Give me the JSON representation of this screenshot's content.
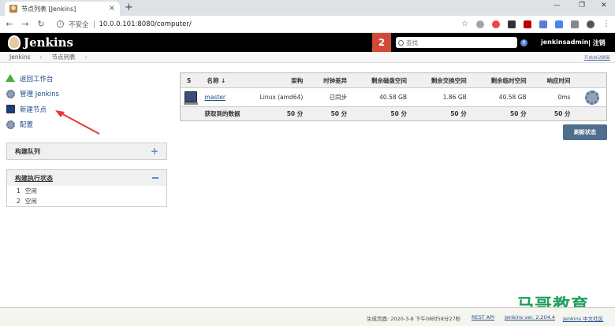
{
  "browser": {
    "tab_title": "节点列表 [Jenkins]",
    "tab_close": "×",
    "new_tab": "+",
    "window_controls": {
      "minimize": "—",
      "restore": "❐",
      "close": "✕"
    },
    "nav": {
      "back": "←",
      "forward": "→",
      "reload": "↻"
    },
    "security_label": "不安全",
    "url": "10.0.0.101:8080/computer/"
  },
  "header": {
    "brand": "Jenkins",
    "notification_count": "2",
    "search_placeholder": "查找",
    "help": "?",
    "user": "jenkinsadmin",
    "logout": "| 注销"
  },
  "breadcrumb": {
    "items": [
      "Jenkins",
      "节点列表"
    ],
    "separator": "›",
    "auto_refresh": "开启自动刷新"
  },
  "side": {
    "tasks": [
      {
        "label": "返回工作台",
        "icon": "up-arrow-icon"
      },
      {
        "label": "管理 Jenkins",
        "icon": "gear-icon"
      },
      {
        "label": "新建节点",
        "icon": "computer-icon"
      },
      {
        "label": "配置",
        "icon": "gear-icon"
      }
    ],
    "build_queue": {
      "title": "构建队列",
      "toggle": "+"
    },
    "executors": {
      "title": "构建执行状态",
      "items": [
        {
          "num": "1",
          "status": "空闲"
        },
        {
          "num": "2",
          "status": "空闲"
        }
      ]
    }
  },
  "table": {
    "headers": [
      "S",
      "名称 ↓",
      "架构",
      "时钟差异",
      "剩余磁盘空间",
      "剩余交换空间",
      "剩余临时空间",
      "响应时间"
    ],
    "rows": [
      {
        "name": "master",
        "arch": "Linux (amd64)",
        "clock": "已同步",
        "disk": "40.58 GB",
        "swap": "1.86 GB",
        "temp": "40.58 GB",
        "response": "0ms"
      }
    ],
    "summary": {
      "label": "获取到的数据",
      "values": [
        "50 分",
        "50 分",
        "50 分",
        "50 分",
        "50 分",
        "50 分"
      ]
    },
    "refresh_button": "刷新状态"
  },
  "footer": {
    "generated": "生成页面: 2020-3-8 下午08时58分27秒",
    "rest_api": "REST API",
    "version": "Jenkins ver. 2.204.4",
    "community": "Jenkins 中文社区"
  },
  "watermark": "马哥教育",
  "colors": {
    "header_bg": "#000000",
    "badge_red": "#d24939",
    "link": "#204a87",
    "refresh_btn": "#4f6f8f",
    "watermark": "#1ea15c"
  }
}
